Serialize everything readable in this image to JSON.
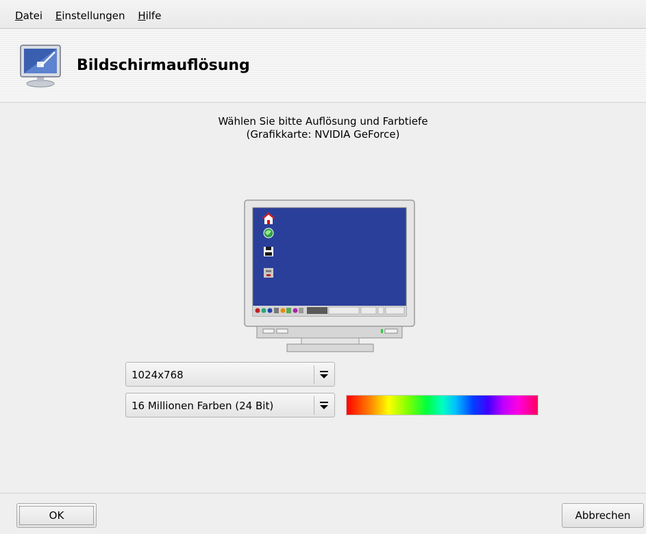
{
  "menubar": {
    "items": [
      {
        "label_first": "D",
        "label_rest": "atei"
      },
      {
        "label_first": "E",
        "label_rest": "instellungen"
      },
      {
        "label_first": "H",
        "label_rest": "ilfe"
      }
    ]
  },
  "header": {
    "title": "Bildschirmauflösung",
    "icon": "monitor-display-icon"
  },
  "main": {
    "instruction_line1": "Wählen Sie bitte Auflösung und Farbtiefe",
    "instruction_line2": "(Grafikkarte: NVIDIA GeForce)",
    "preview_icon": "monitor-preview-icon",
    "resolution": {
      "selected": "1024x768"
    },
    "color_depth": {
      "selected": "16 Millionen Farben (24 Bit)"
    }
  },
  "footer": {
    "ok_label": "OK",
    "cancel_label": "Abbrechen"
  },
  "colors": {
    "window_bg": "#efefef",
    "desktop_blue": "#2a3f9a"
  }
}
